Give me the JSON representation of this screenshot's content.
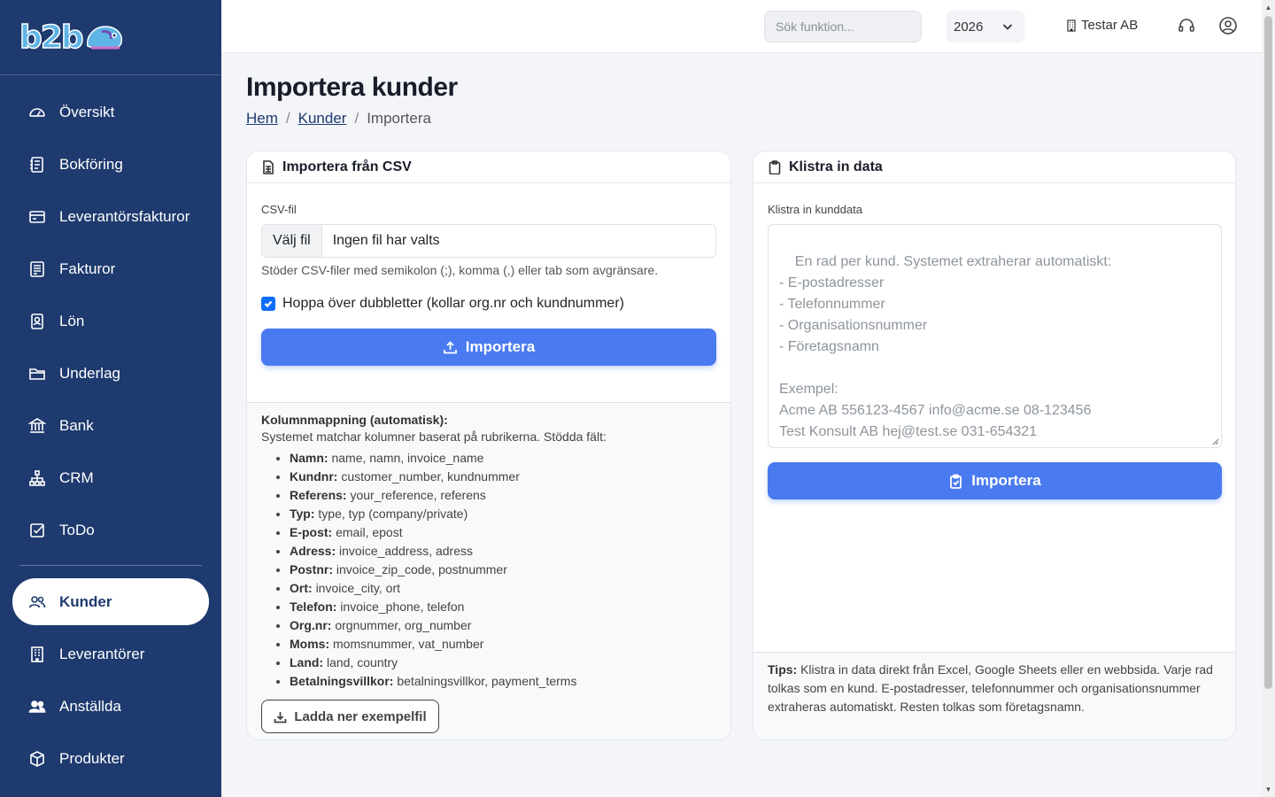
{
  "brand": {
    "logo_text": "b2b"
  },
  "sidebar": {
    "items": [
      {
        "label": "Översikt",
        "icon": "dashboard-icon"
      },
      {
        "label": "Bokföring",
        "icon": "journal-icon"
      },
      {
        "label": "Leverantörsfakturor",
        "icon": "credit-card-icon"
      },
      {
        "label": "Fakturor",
        "icon": "invoice-icon"
      },
      {
        "label": "Lön",
        "icon": "badge-icon"
      },
      {
        "label": "Underlag",
        "icon": "folder-icon"
      },
      {
        "label": "Bank",
        "icon": "bank-icon"
      },
      {
        "label": "CRM",
        "icon": "diagram-icon"
      },
      {
        "label": "ToDo",
        "icon": "checkbox-icon"
      }
    ],
    "items2": [
      {
        "label": "Kunder",
        "icon": "people-icon",
        "active": true
      },
      {
        "label": "Leverantörer",
        "icon": "building-icon"
      },
      {
        "label": "Anställda",
        "icon": "people-fill-icon"
      },
      {
        "label": "Produkter",
        "icon": "box-icon"
      }
    ]
  },
  "topbar": {
    "search_placeholder": "Sök funktion...",
    "year": "2026",
    "company": "Testar AB"
  },
  "page": {
    "title": "Importera kunder",
    "breadcrumb": {
      "home": "Hem",
      "section": "Kunder",
      "current": "Importera",
      "separator": "/"
    }
  },
  "csv_card": {
    "title": "Importera från CSV",
    "file_label": "CSV-fil",
    "file_button": "Välj fil",
    "file_name": "Ingen fil har valts",
    "hint": "Stöder CSV-filer med semikolon (;), komma (,) eller tab som avgränsare.",
    "skip_duplicates_label": "Hoppa över dubbletter (kollar org.nr och kundnummer)",
    "skip_duplicates_checked": true,
    "import_button": "Importera",
    "mapping_title": "Kolumnmappning (automatisk):",
    "mapping_desc": "Systemet matchar kolumner baserat på rubrikerna. Stödda fält:",
    "mapping": [
      {
        "field": "Namn:",
        "aliases": "name, namn, invoice_name"
      },
      {
        "field": "Kundnr:",
        "aliases": "customer_number, kundnummer"
      },
      {
        "field": "Referens:",
        "aliases": "your_reference, referens"
      },
      {
        "field": "Typ:",
        "aliases": "type, typ (company/private)"
      },
      {
        "field": "E-post:",
        "aliases": "email, epost"
      },
      {
        "field": "Adress:",
        "aliases": "invoice_address, adress"
      },
      {
        "field": "Postnr:",
        "aliases": "invoice_zip_code, postnummer"
      },
      {
        "field": "Ort:",
        "aliases": "invoice_city, ort"
      },
      {
        "field": "Telefon:",
        "aliases": "invoice_phone, telefon"
      },
      {
        "field": "Org.nr:",
        "aliases": "orgnummer, org_number"
      },
      {
        "field": "Moms:",
        "aliases": "momsnummer, vat_number"
      },
      {
        "field": "Land:",
        "aliases": "land, country"
      },
      {
        "field": "Betalningsvillkor:",
        "aliases": "betalningsvillkor, payment_terms"
      }
    ],
    "download_button": "Ladda ner exempelfil"
  },
  "paste_card": {
    "title": "Klistra in data",
    "textarea_label": "Klistra in kunddata",
    "textarea_placeholder": "En rad per kund. Systemet extraherar automatiskt:\n- E-postadresser\n- Telefonnummer\n- Organisationsnummer\n- Företagsnamn\n\nExempel:\nAcme AB 556123-4567 info@acme.se 08-123456\nTest Konsult AB hej@test.se 031-654321",
    "import_button": "Importera",
    "tips_label": "Tips:",
    "tips_text": " Klistra in data direkt från Excel, Google Sheets eller en webbsida. Varje rad tolkas som en kund. E-postadresser, telefonnummer och organisationsnummer extraheras automatiskt. Resten tolkas som företagsnamn."
  },
  "colors": {
    "sidebar": "#1e3a6e",
    "primary": "#4a7af0",
    "background": "#f3f5f9"
  }
}
